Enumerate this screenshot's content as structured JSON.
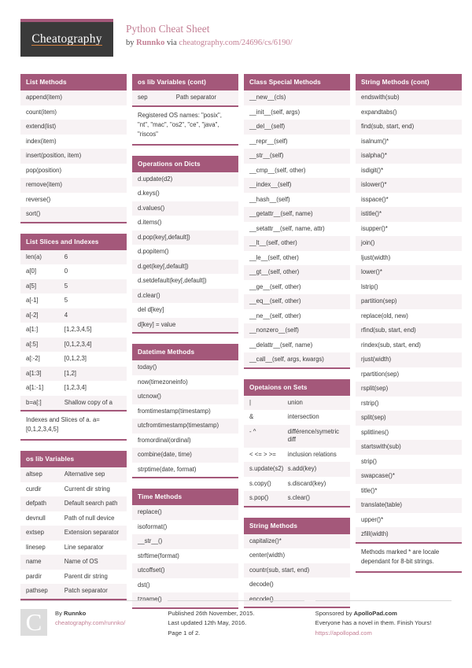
{
  "header": {
    "logo": "Cheatography",
    "title": "Python Cheat Sheet",
    "by_prefix": "by ",
    "author": "Runnko",
    "via": " via ",
    "source_url": "cheatography.com/24696/cs/6190/"
  },
  "colors": {
    "accent": "#a4587a",
    "title_pink": "#c48095",
    "logo_bg": "#3a3a3a",
    "logo_underline": "#d4803f",
    "row_alt": "#f7f2f4"
  },
  "columns": [
    {
      "cards": [
        {
          "title": "List Methods",
          "layout": "single",
          "rows": [
            [
              "append(item)"
            ],
            [
              "count(item)"
            ],
            [
              "extend(list)"
            ],
            [
              "index(item)"
            ],
            [
              "insert(position, item)"
            ],
            [
              "pop(position)"
            ],
            [
              "remove(item)"
            ],
            [
              "reverse()"
            ],
            [
              "sort()"
            ]
          ]
        },
        {
          "title": "List Slices and Indexes",
          "layout": "pair",
          "rows": [
            [
              "len(a)",
              "6"
            ],
            [
              "a[0]",
              "0"
            ],
            [
              "a[5]",
              "5"
            ],
            [
              "a[-1]",
              "5"
            ],
            [
              "a[-2]",
              "4"
            ],
            [
              "a[1:]",
              "[1,2,3,4,5]"
            ],
            [
              "a[:5]",
              "[0,1,2,3,4]"
            ],
            [
              "a[:-2]",
              "[0,1,2,3]"
            ],
            [
              "a[1:3]",
              "[1,2]"
            ],
            [
              "a[1:-1]",
              "[1,2,3,4]"
            ],
            [
              "b=a[:]",
              "Shallow copy of a"
            ]
          ],
          "note": "Indexes and Slices of a. a=[0,1,2,3,4,5]"
        },
        {
          "title": "os lib Variables",
          "layout": "pair",
          "rows": [
            [
              "altsep",
              "Alternative sep"
            ],
            [
              "curdir",
              "Current dir string"
            ],
            [
              "defpath",
              "Default search path"
            ],
            [
              "devnull",
              "Path of null device"
            ],
            [
              "extsep",
              "Extension separator"
            ],
            [
              "linesep",
              "Line separator"
            ],
            [
              "name",
              "Name of OS"
            ],
            [
              "pardir",
              "Parent dir string"
            ],
            [
              "pathsep",
              "Patch separator"
            ]
          ]
        }
      ]
    },
    {
      "cards": [
        {
          "title": "os lib Variables (cont)",
          "layout": "pair",
          "rows": [
            [
              "sep",
              "Path separator"
            ]
          ],
          "note": "Registered OS names: \"posix\", \"nt\", \"mac\", \"os2\", \"ce\", \"java\", \"riscos\""
        },
        {
          "title": "Operations on Dicts",
          "layout": "single",
          "rows": [
            [
              "d.update(d2)"
            ],
            [
              "d.keys()"
            ],
            [
              "d.values()"
            ],
            [
              "d.items()"
            ],
            [
              "d.pop(key[,default])"
            ],
            [
              "d.popitem()"
            ],
            [
              "d.get(key[,default])"
            ],
            [
              "d.setdefault(key[,default])"
            ],
            [
              "d.clear()"
            ],
            [
              "del d[key]"
            ],
            [
              "d[key] = value"
            ]
          ]
        },
        {
          "title": "Datetime Methods",
          "layout": "single",
          "rows": [
            [
              "today()"
            ],
            [
              "now(timezoneinfo)"
            ],
            [
              "utcnow()"
            ],
            [
              "fromtimestamp(timestamp)"
            ],
            [
              "utcfromtimestamp(timestamp)"
            ],
            [
              "fromordinal(ordinal)"
            ],
            [
              "combine(date, time)"
            ],
            [
              "strptime(date, format)"
            ]
          ]
        },
        {
          "title": "Time Methods",
          "layout": "single",
          "rows": [
            [
              "replace()"
            ],
            [
              "isoformat()"
            ],
            [
              "__str__()"
            ],
            [
              "strftime(format)"
            ],
            [
              "utcoffset()"
            ],
            [
              "dst()"
            ],
            [
              "tzname()"
            ]
          ]
        }
      ]
    },
    {
      "cards": [
        {
          "title": "Class Special Methods",
          "layout": "single",
          "rows": [
            [
              "__new__(cls)"
            ],
            [
              "__init__(self, args)"
            ],
            [
              "__del__(self)"
            ],
            [
              "__repr__(self)"
            ],
            [
              "__str__(self)"
            ],
            [
              "__cmp__(self, other)"
            ],
            [
              "__index__(self)"
            ],
            [
              "__hash__(self)"
            ],
            [
              "__getattr__(self, name)"
            ],
            [
              "__setattr__(self, name, attr)"
            ],
            [
              "__lt__(self, other)"
            ],
            [
              "__le__(self, other)"
            ],
            [
              "__gt__(self, other)"
            ],
            [
              "__ge__(self, other)"
            ],
            [
              "__eq__(self, other)"
            ],
            [
              "__ne__(self, other)"
            ],
            [
              "__nonzero__(self)"
            ],
            [
              "__delattr__(self, name)"
            ],
            [
              "__call__(self, args, kwargs)"
            ]
          ]
        },
        {
          "title": "Opetaions on Sets",
          "layout": "pair",
          "rows": [
            [
              "|",
              "union"
            ],
            [
              "&",
              "intersection"
            ],
            [
              "- ^",
              "différence/symetric diff"
            ],
            [
              "< <= > >=",
              "inclusion relations"
            ],
            [
              "s.update(s2)",
              "s.add(key)"
            ],
            [
              "s.copy()",
              "s.discard(key)"
            ],
            [
              "s.pop()",
              "s.clear()"
            ]
          ]
        },
        {
          "title": "String Methods",
          "layout": "single",
          "rows": [
            [
              "capitalize()*"
            ],
            [
              "center(width)"
            ],
            [
              "countr(sub, start, end)"
            ],
            [
              "decode()"
            ],
            [
              "encode()"
            ]
          ]
        }
      ]
    },
    {
      "cards": [
        {
          "title": "String Methods (cont)",
          "layout": "single",
          "rows": [
            [
              "endswith(sub)"
            ],
            [
              "expandtabs()"
            ],
            [
              "find(sub, start, end)"
            ],
            [
              "isalnum()*"
            ],
            [
              "isalpha()*"
            ],
            [
              "isdigit()*"
            ],
            [
              "islower()*"
            ],
            [
              "isspace()*"
            ],
            [
              "istitle()*"
            ],
            [
              "isupper()*"
            ],
            [
              "join()"
            ],
            [
              "ljust(width)"
            ],
            [
              "lower()*"
            ],
            [
              "lstrip()"
            ],
            [
              "partition(sep)"
            ],
            [
              "replace(old, new)"
            ],
            [
              "rfind(sub, start, end)"
            ],
            [
              "rindex(sub, start, end)"
            ],
            [
              "rjust(width)"
            ],
            [
              "rpartition(sep)"
            ],
            [
              "rsplit(sep)"
            ],
            [
              "rstrip()"
            ],
            [
              "split(sep)"
            ],
            [
              "splitlines()"
            ],
            [
              "startswith(sub)"
            ],
            [
              "strip()"
            ],
            [
              "swapcase()*"
            ],
            [
              "title()*"
            ],
            [
              "translate(table)"
            ],
            [
              "upper()*"
            ],
            [
              "zfill(width)"
            ]
          ],
          "note": "Methods marked * are locale dependant for 8-bit strings."
        }
      ]
    }
  ],
  "footer": {
    "badge": "C",
    "author_prefix": "By ",
    "author": "Runnko",
    "author_url": "cheatography.com/runnko/",
    "published": "Published 26th November, 2015.",
    "updated": "Last updated 12th May, 2016.",
    "page": "Page 1 of 2.",
    "sponsor_prefix": "Sponsored by ",
    "sponsor": "ApolloPad.com",
    "sponsor_tagline": "Everyone has a novel in them. Finish Yours!",
    "sponsor_url": "https://apollopad.com"
  }
}
